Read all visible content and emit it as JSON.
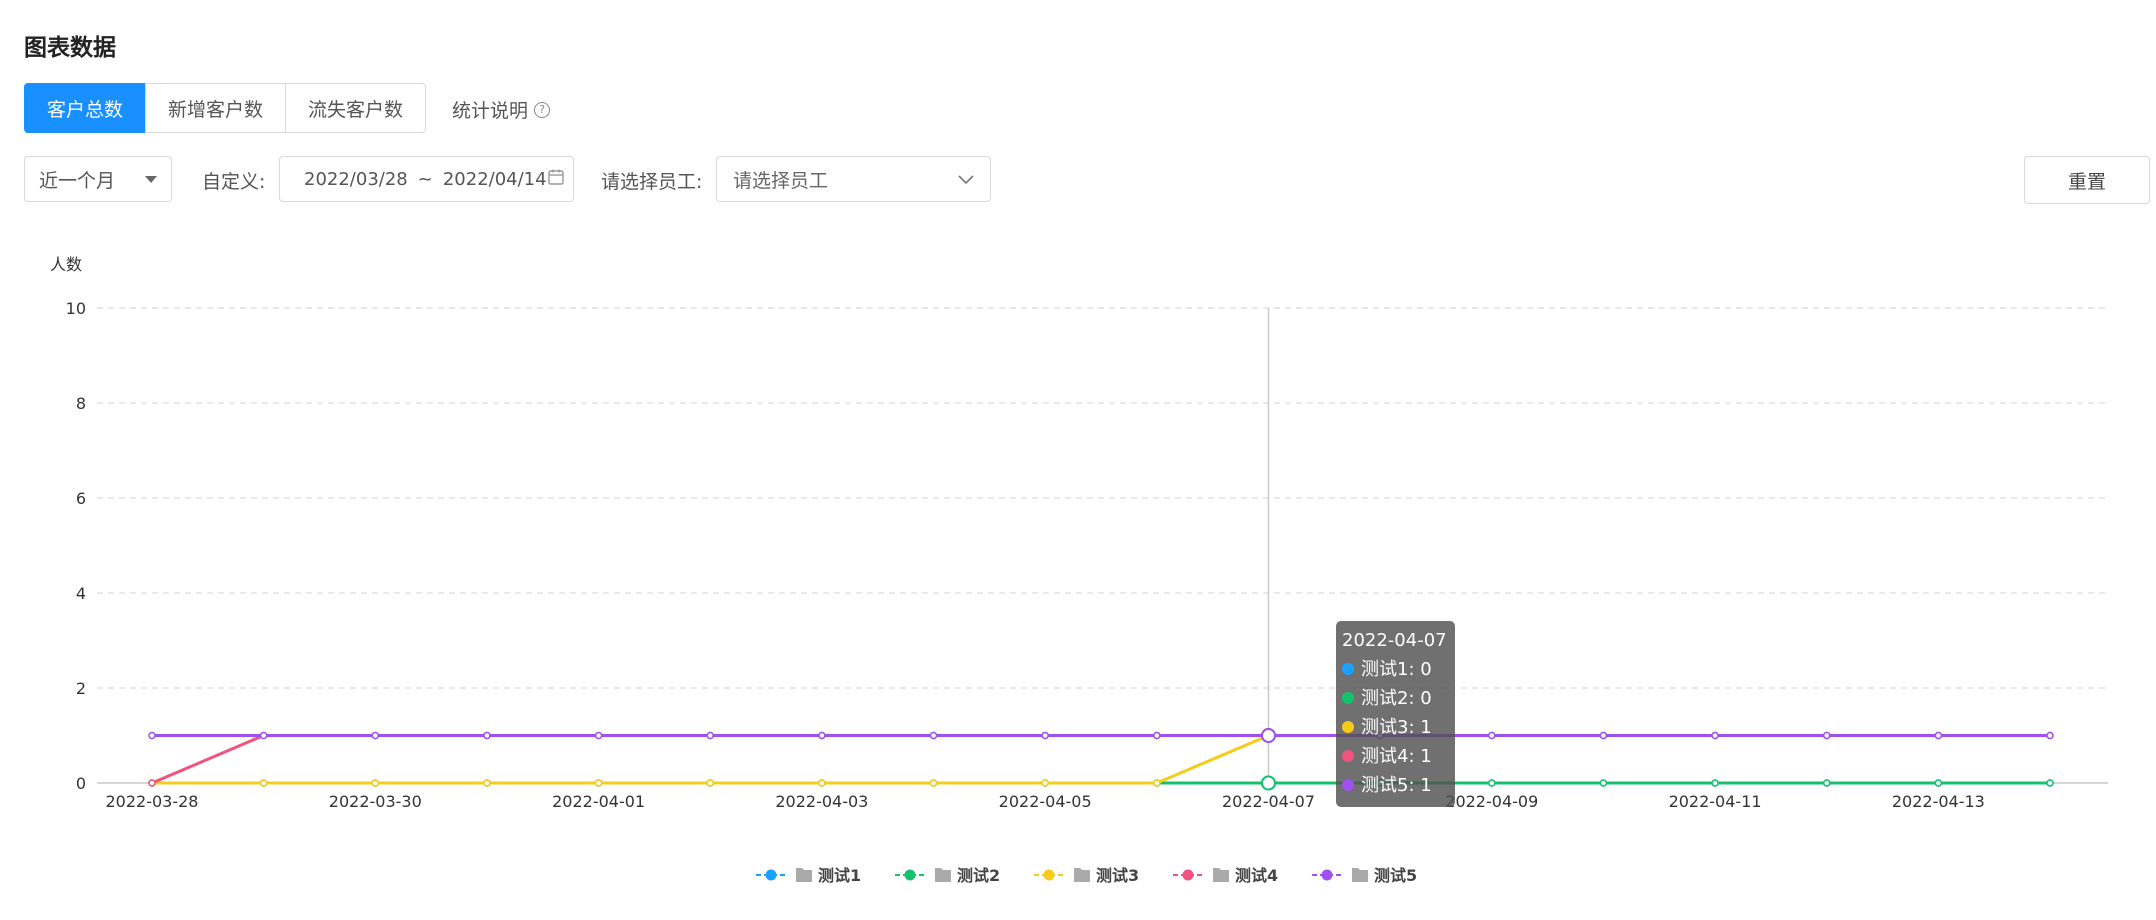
{
  "page_title": "图表数据",
  "tabs": [
    {
      "label": "客户总数",
      "active": true
    },
    {
      "label": "新增客户数",
      "active": false
    },
    {
      "label": "流失客户数",
      "active": false
    }
  ],
  "stat_help_label": "统计说明",
  "filters": {
    "period_selected": "近一个月",
    "custom_label": "自定义:",
    "date_start": "2022/03/28",
    "date_sep": "~",
    "date_end": "2022/04/14",
    "employee_label": "请选择员工:",
    "employee_placeholder": "请选择员工",
    "reset_label": "重置"
  },
  "chart_data": {
    "type": "line",
    "ylabel": "人数",
    "ylim": [
      0,
      10
    ],
    "yticks": [
      0,
      2,
      4,
      6,
      8,
      10
    ],
    "x": [
      "2022-03-28",
      "2022-03-29",
      "2022-03-30",
      "2022-03-31",
      "2022-04-01",
      "2022-04-02",
      "2022-04-03",
      "2022-04-04",
      "2022-04-05",
      "2022-04-06",
      "2022-04-07",
      "2022-04-08",
      "2022-04-09",
      "2022-04-10",
      "2022-04-11",
      "2022-04-12",
      "2022-04-13",
      "2022-04-14"
    ],
    "xtick_labels": [
      "2022-03-28",
      "2022-03-30",
      "2022-04-01",
      "2022-04-03",
      "2022-04-05",
      "2022-04-07",
      "2022-04-09",
      "2022-04-11",
      "2022-04-13"
    ],
    "grid": true,
    "legend_position": "bottom",
    "series": [
      {
        "name": "测试1",
        "color": "#1aa1ff",
        "values": [
          0,
          0,
          0,
          0,
          0,
          0,
          0,
          0,
          0,
          0,
          0,
          0,
          0,
          0,
          0,
          0,
          0,
          0
        ]
      },
      {
        "name": "测试2",
        "color": "#13c26b",
        "values": [
          0,
          0,
          0,
          0,
          0,
          0,
          0,
          0,
          0,
          0,
          0,
          0,
          0,
          0,
          0,
          0,
          0,
          0
        ]
      },
      {
        "name": "测试3",
        "color": "#f5cc19",
        "values": [
          0,
          0,
          0,
          0,
          0,
          0,
          0,
          0,
          0,
          0,
          1,
          1,
          1,
          1,
          1,
          1,
          1,
          1
        ]
      },
      {
        "name": "测试4",
        "color": "#f0537e",
        "values": [
          0,
          1,
          1,
          1,
          1,
          1,
          1,
          1,
          1,
          1,
          1,
          1,
          1,
          1,
          1,
          1,
          1,
          1
        ]
      },
      {
        "name": "测试5",
        "color": "#a04ff0",
        "values": [
          1,
          1,
          1,
          1,
          1,
          1,
          1,
          1,
          1,
          1,
          1,
          1,
          1,
          1,
          1,
          1,
          1,
          1
        ]
      }
    ],
    "tooltip": {
      "x": "2022-04-07",
      "title": "2022-04-07",
      "lines": [
        "测试1: 0",
        "测试2: 0",
        "测试3: 1",
        "测试4: 1",
        "测试5: 1"
      ]
    }
  }
}
